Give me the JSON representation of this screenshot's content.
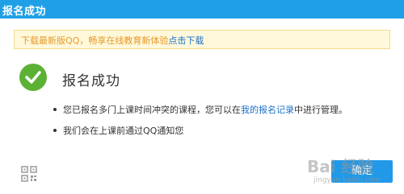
{
  "window": {
    "title": "报名成功"
  },
  "notice": {
    "text": "下载最新版QQ，畅享在线教育新体验",
    "link": "点击下载"
  },
  "result": {
    "icon": "check-circle-icon",
    "headline": "报名成功"
  },
  "messages": {
    "line1_before": "您已报名多门上课时间冲突的课程，您可以在",
    "line1_link": "我的报名记录",
    "line1_after": "中进行管理。",
    "line2": "我们会在上课前通过QQ通知您"
  },
  "footer": {
    "qr_icon": "qr-code-icon",
    "confirm_label": "确定"
  },
  "watermark": {
    "text": "Bai 经验",
    "sub": "jingyan.baidu.com"
  },
  "colors": {
    "titlebar": "#1fa0e6",
    "link": "#1a6fc9",
    "success": "#5cb135",
    "notice_bg": "#fff8db",
    "notice_text": "#e69a28",
    "button": "#2299e8"
  }
}
